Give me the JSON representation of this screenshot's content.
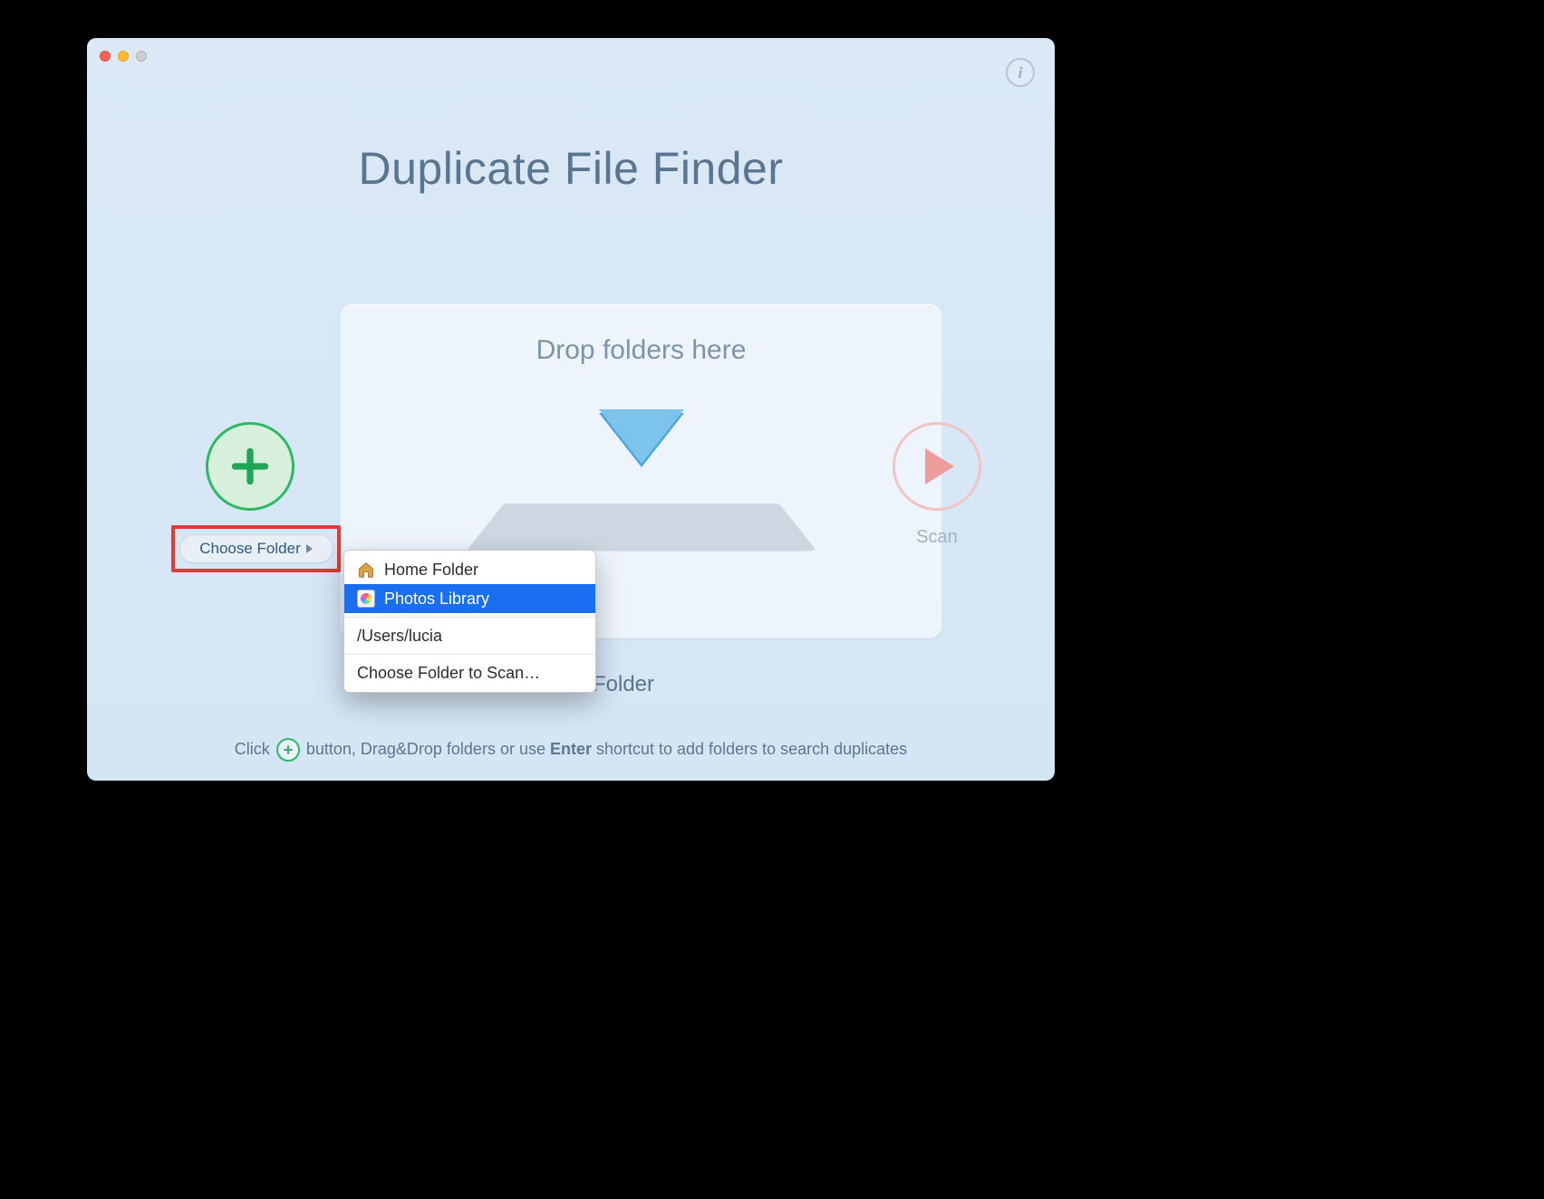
{
  "window": {
    "title": "Duplicate File Finder",
    "info_icon_label": "i"
  },
  "drop_zone": {
    "title": "Drop folders here"
  },
  "choose_folder": {
    "button_label": "Choose Folder"
  },
  "scan": {
    "button_label": "Scan"
  },
  "scan_home_text": "can Home Folder",
  "instruction": {
    "pre": "Click",
    "mid": " button, Drag&Drop folders or use ",
    "bold": "Enter",
    "post": " shortcut to add folders to search duplicates"
  },
  "menu": {
    "items": [
      {
        "label": "Home Folder",
        "icon": "house"
      },
      {
        "label": "Photos Library",
        "icon": "photos",
        "selected": true
      }
    ],
    "recent": "/Users/lucia",
    "choose": "Choose Folder to Scan…"
  }
}
